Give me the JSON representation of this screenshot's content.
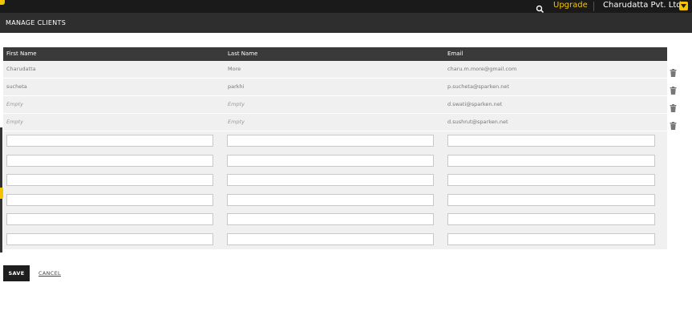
{
  "topbar": {
    "upgrade_label": "Upgrade",
    "company_name": "Charudatta Pvt. Ltd",
    "icons": {
      "search": "search-icon",
      "dropdown": "chevron-down-icon"
    },
    "colors": {
      "bar": "#1a1a1a",
      "accent": "#f5c400"
    }
  },
  "header": {
    "title": "MANAGE CLIENTS"
  },
  "table": {
    "columns": [
      "First Name",
      "Last Name",
      "Email"
    ],
    "rows": [
      {
        "first_name": "Charudatta",
        "last_name": "More",
        "email": "charu.m.more@gmail.com"
      },
      {
        "first_name": "sucheta",
        "last_name": "parkhi",
        "email": "p.sucheta@sparken.net"
      },
      {
        "first_name": "Empty",
        "last_name": "Empty",
        "email": "d.swati@sparken.net"
      },
      {
        "first_name": "Empty",
        "last_name": "Empty",
        "email": "d.sushrut@sparken.net"
      }
    ],
    "row_action_icon": "trash-icon",
    "new_rows": [
      {
        "first_name": "",
        "last_name": "",
        "email": ""
      },
      {
        "first_name": "",
        "last_name": "",
        "email": ""
      },
      {
        "first_name": "",
        "last_name": "",
        "email": ""
      },
      {
        "first_name": "",
        "last_name": "",
        "email": ""
      },
      {
        "first_name": "",
        "last_name": "",
        "email": ""
      },
      {
        "first_name": "",
        "last_name": "",
        "email": ""
      }
    ]
  },
  "actions": {
    "save_label": "SAVE",
    "cancel_label": "CANCEL"
  }
}
